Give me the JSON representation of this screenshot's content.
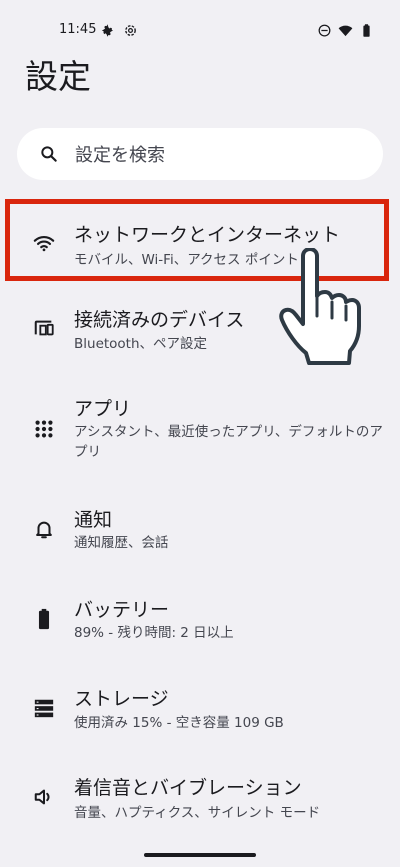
{
  "status_bar": {
    "time": "11:45",
    "left_icons": [
      "gear-icon",
      "settings-cog-icon"
    ],
    "right_icons": [
      "do-not-disturb-icon",
      "wifi-icon",
      "battery-icon"
    ]
  },
  "page_title": "設定",
  "search": {
    "placeholder": "設定を検索"
  },
  "settings": [
    {
      "id": "network",
      "title": "ネットワークとインターネット",
      "subtitle": "モバイル、Wi-Fi、アクセス ポイント",
      "icon": "wifi-icon",
      "highlighted": true
    },
    {
      "id": "devices",
      "title": "接続済みのデバイス",
      "subtitle": "Bluetooth、ペア設定",
      "icon": "connected-devices-icon"
    },
    {
      "id": "apps",
      "title": "アプリ",
      "subtitle": "アシスタント、最近使ったアプリ、デフォルトのアプリ",
      "icon": "apps-grid-icon"
    },
    {
      "id": "notifications",
      "title": "通知",
      "subtitle": "通知履歴、会話",
      "icon": "bell-icon"
    },
    {
      "id": "battery",
      "title": "バッテリー",
      "subtitle": "89% - 残り時間: 2 日以上",
      "icon": "battery-icon"
    },
    {
      "id": "storage",
      "title": "ストレージ",
      "subtitle": "使用済み 15% - 空き容量 109 GB",
      "icon": "storage-icon"
    },
    {
      "id": "sound",
      "title": "着信音とバイブレーション",
      "subtitle": "音量、ハプティクス、サイレント モード",
      "icon": "volume-icon"
    }
  ],
  "colors": {
    "background": "#f1f0f4",
    "highlight": "#d9260d",
    "text_primary": "#1b1b1f",
    "text_secondary": "#44464f"
  }
}
